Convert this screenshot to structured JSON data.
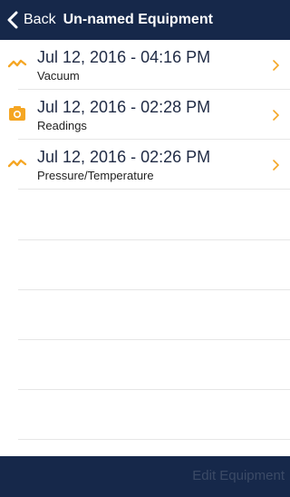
{
  "navbar": {
    "back_label": "Back",
    "title": "Un-named Equipment"
  },
  "entries": [
    {
      "date": "Jul 12, 2016 - 04:16 PM",
      "type": "Vacuum",
      "icon": "wave-icon"
    },
    {
      "date": "Jul 12, 2016 - 02:28 PM",
      "type": "Readings",
      "icon": "camera-icon"
    },
    {
      "date": "Jul 12, 2016 - 02:26 PM",
      "type": "Pressure/Temperature",
      "icon": "wave-icon"
    }
  ],
  "footer": {
    "edit_label": "Edit Equipment"
  },
  "colors": {
    "navbar_bg": "#16284a",
    "accent_orange": "#f5a623",
    "separator": "#e6e6e6",
    "disabled_text": "#3b4a66"
  }
}
